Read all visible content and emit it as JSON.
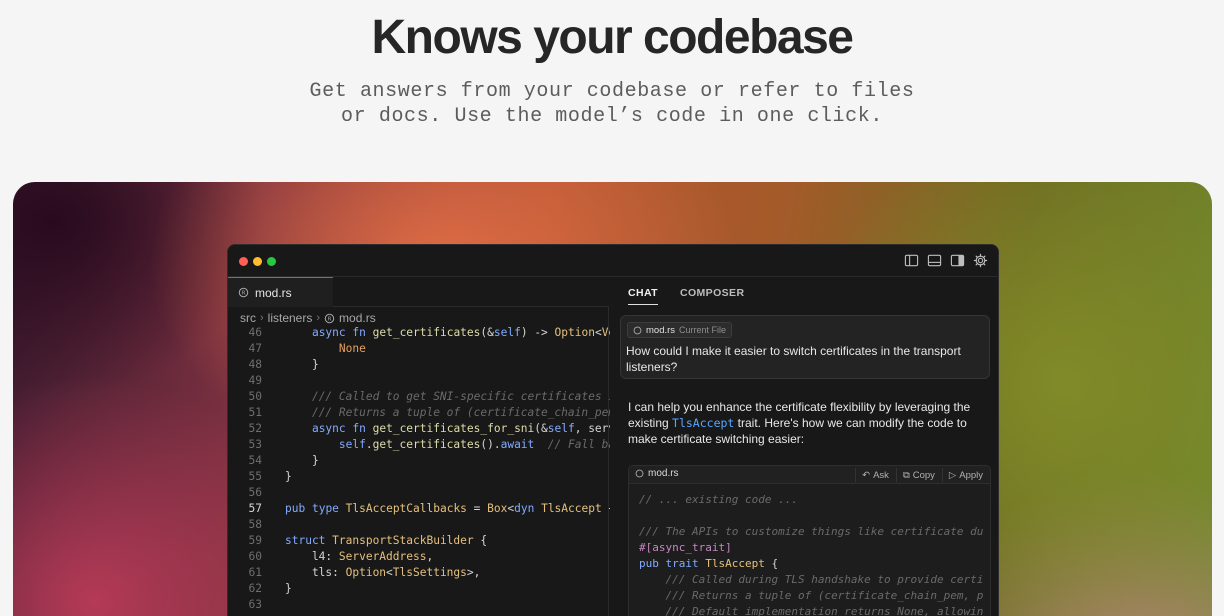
{
  "hero": {
    "title": "Knows your codebase",
    "subtitle_line1": "Get answers from your codebase or refer to files",
    "subtitle_line2": "or docs. Use the model’s code in one click."
  },
  "window": {
    "titlebar_icons": [
      "sidebar-left-icon",
      "panel-bottom-icon",
      "sidebar-right-icon",
      "gear-icon"
    ]
  },
  "editor": {
    "tab_label": "mod.rs",
    "breadcrumb": [
      "src",
      "listeners",
      "mod.rs"
    ],
    "lines": [
      {
        "n": "46",
        "text": "    async fn get_certificates(&self) -> Option<Vec"
      },
      {
        "n": "47",
        "text": "        None"
      },
      {
        "n": "48",
        "text": "    }"
      },
      {
        "n": "49",
        "text": ""
      },
      {
        "n": "50",
        "text": "    /// Called to get SNI-specific certificates if"
      },
      {
        "n": "51",
        "text": "    /// Returns a tuple of (certificate_chain_pem,"
      },
      {
        "n": "52",
        "text": "    async fn get_certificates_for_sni(&self, server"
      },
      {
        "n": "53",
        "text": "        self.get_certificates().await  // Fall back"
      },
      {
        "n": "54",
        "text": "    }"
      },
      {
        "n": "55",
        "text": "}"
      },
      {
        "n": "56",
        "text": ""
      },
      {
        "n": "57",
        "text": "pub type TlsAcceptCallbacks = Box<dyn TlsAccept + S"
      },
      {
        "n": "58",
        "text": ""
      },
      {
        "n": "59",
        "text": "struct TransportStackBuilder {"
      },
      {
        "n": "60",
        "text": "    l4: ServerAddress,"
      },
      {
        "n": "61",
        "text": "    tls: Option<TlsSettings>,"
      },
      {
        "n": "62",
        "text": "}"
      },
      {
        "n": "63",
        "text": ""
      }
    ],
    "active_line": "57"
  },
  "chat": {
    "tabs": [
      "CHAT",
      "COMPOSER"
    ],
    "file_chip_name": "mod.rs",
    "file_chip_tag": "Current File",
    "question": "How could I make it easier to switch certificates in the transport listeners?",
    "reply_part1": "I can help you enhance the certificate flexibility by leveraging the existing ",
    "reply_code": "TlsAccept",
    "reply_part2": " trait. Here's how we can modify the code to make certificate switching easier:",
    "code_block": {
      "file": "mod.rs",
      "actions": [
        "Ask",
        "Copy",
        "Apply"
      ],
      "lines": [
        "// ... existing code ...",
        "",
        "/// The APIs to customize things like certificate du",
        "#[async_trait]",
        "pub trait TlsAccept {",
        "    /// Called during TLS handshake to provide certi",
        "    /// Returns a tuple of (certificate_chain_pem, p",
        "    /// Default implementation returns None, allowin"
      ]
    }
  }
}
